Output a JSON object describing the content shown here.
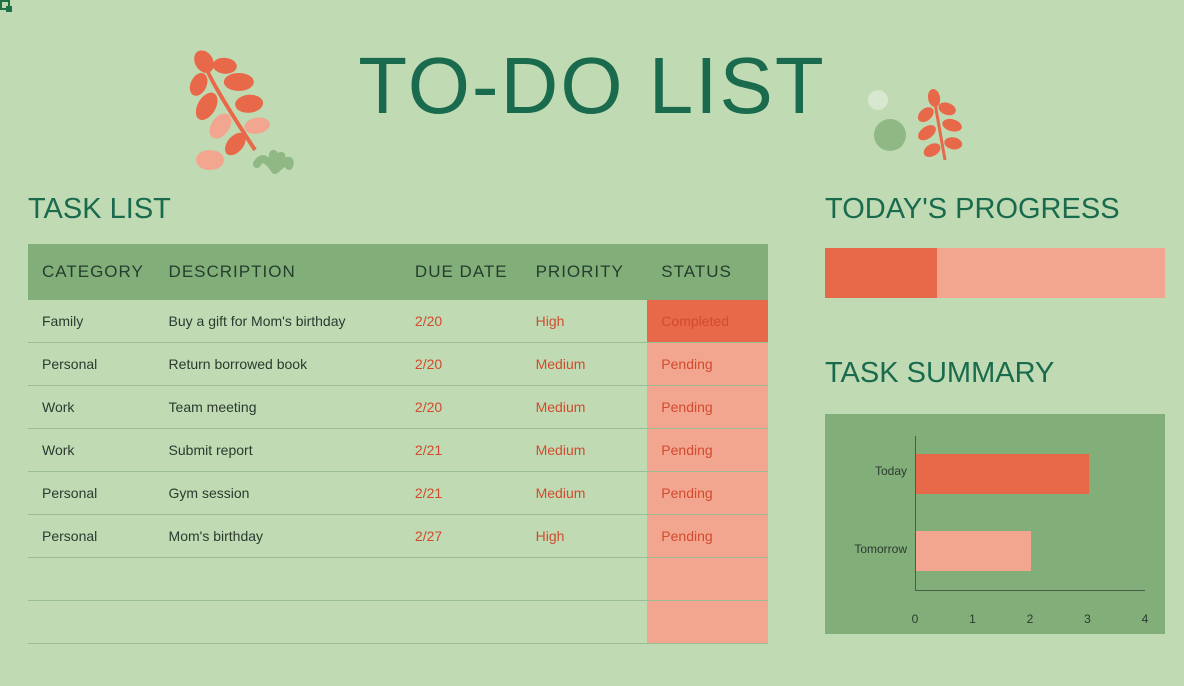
{
  "title": "TO-DO LIST",
  "sections": {
    "task_list": "TASK LIST",
    "progress": "TODAY'S PROGRESS",
    "summary": "TASK SUMMARY"
  },
  "columns": {
    "category": "CATEGORY",
    "description": "DESCRIPTION",
    "due": "DUE DATE",
    "priority": "PRIORITY",
    "status": "STATUS"
  },
  "tasks": [
    {
      "category": "Family",
      "description": "Buy a gift for Mom's birthday",
      "due": "2/20",
      "priority": "High",
      "status": "Completed"
    },
    {
      "category": "Personal",
      "description": "Return borrowed book",
      "due": "2/20",
      "priority": "Medium",
      "status": "Pending"
    },
    {
      "category": "Work",
      "description": "Team meeting",
      "due": "2/20",
      "priority": "Medium",
      "status": "Pending"
    },
    {
      "category": "Work",
      "description": "Submit report",
      "due": "2/21",
      "priority": "Medium",
      "status": "Pending"
    },
    {
      "category": "Personal",
      "description": "Gym session",
      "due": "2/21",
      "priority": "Medium",
      "status": "Pending"
    },
    {
      "category": "Personal",
      "description": "Mom's birthday",
      "due": "2/27",
      "priority": "High",
      "status": "Pending"
    }
  ],
  "empty_rows": 2,
  "progress_percent": 33,
  "chart_data": {
    "type": "bar",
    "orientation": "horizontal",
    "categories": [
      "Today",
      "Tomorrow"
    ],
    "values": [
      3,
      2
    ],
    "xlim": [
      0,
      4
    ],
    "xticks": [
      0,
      1,
      2,
      3,
      4
    ],
    "colors": [
      "#e8694a",
      "#f2a68f"
    ]
  }
}
